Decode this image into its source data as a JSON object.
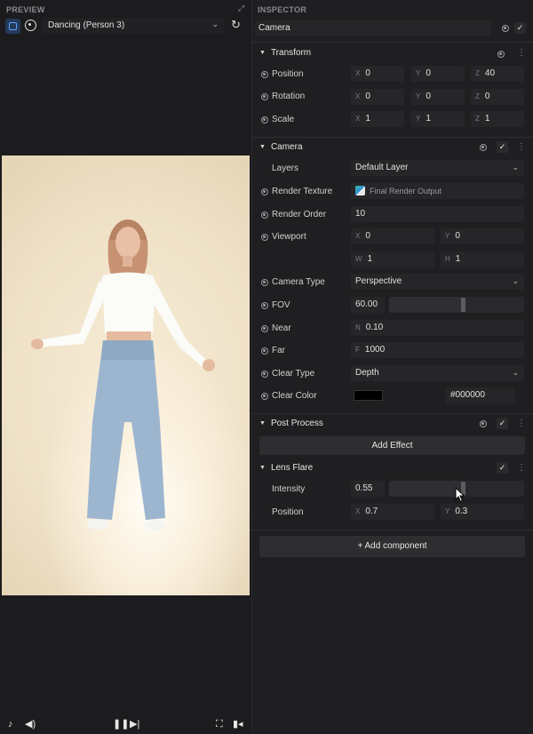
{
  "preview": {
    "title": "PREVIEW",
    "scene_select": "Dancing (Person 3)"
  },
  "inspector": {
    "title": "INSPECTOR",
    "object_name": "Camera",
    "transform": {
      "header": "Transform",
      "position": {
        "label": "Position",
        "x": "0",
        "y": "0",
        "z": "40"
      },
      "rotation": {
        "label": "Rotation",
        "x": "0",
        "y": "0",
        "z": "0"
      },
      "scale": {
        "label": "Scale",
        "x": "1",
        "y": "1",
        "z": "1"
      }
    },
    "camera": {
      "header": "Camera",
      "layers": {
        "label": "Layers",
        "value": "Default Layer"
      },
      "render_texture": {
        "label": "Render Texture",
        "value": "Final Render Output"
      },
      "render_order": {
        "label": "Render Order",
        "value": "10"
      },
      "viewport": {
        "label": "Viewport",
        "x": "0",
        "y": "0",
        "w": "1",
        "h": "1"
      },
      "camera_type": {
        "label": "Camera Type",
        "value": "Perspective"
      },
      "fov": {
        "label": "FOV",
        "value": "60.00",
        "fraction": 0.55
      },
      "near": {
        "label": "Near",
        "value": "0.10"
      },
      "far": {
        "label": "Far",
        "value": "1000"
      },
      "clear_type": {
        "label": "Clear Type",
        "value": "Depth"
      },
      "clear_color": {
        "label": "Clear Color",
        "value": "#000000",
        "swatch": "#000000"
      }
    },
    "post_process": {
      "header": "Post Process",
      "add_effect": "Add Effect",
      "lens_flare": {
        "header": "Lens Flare",
        "intensity": {
          "label": "Intensity",
          "value": "0.55",
          "fraction": 0.55
        },
        "position": {
          "label": "Position",
          "x": "0.7",
          "y": "0.3"
        }
      }
    },
    "add_component": "+ Add component"
  },
  "axes": {
    "x": "X",
    "y": "Y",
    "z": "Z",
    "w": "W",
    "h": "H",
    "n": "N",
    "f": "F"
  },
  "colors": {
    "accent": "#5aa2ff",
    "panel": "#1f1f21",
    "field": "#262629"
  },
  "icons": [
    "camera-icon",
    "webcam-icon",
    "refresh-icon",
    "expand-icon",
    "tiktok-icon",
    "volume-icon",
    "pause-icon",
    "step-forward-icon",
    "screenshot-icon",
    "record-icon"
  ]
}
